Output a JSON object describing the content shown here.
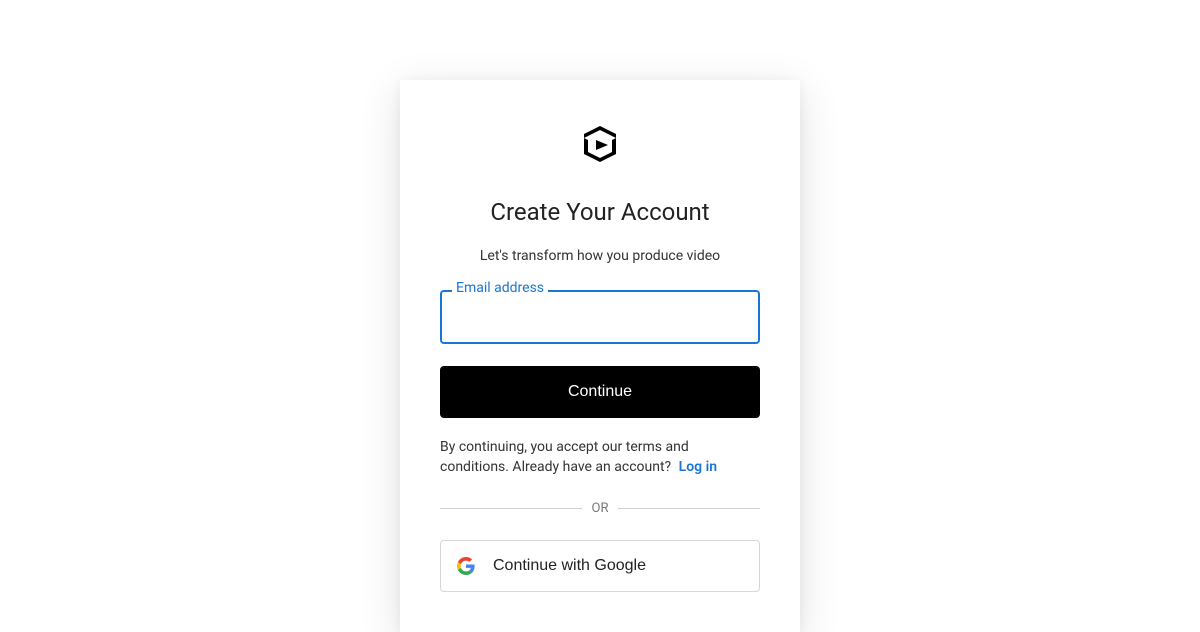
{
  "header": {
    "title": "Create Your Account",
    "subtitle": "Let's transform how you produce video"
  },
  "form": {
    "email_label": "Email address",
    "email_value": "",
    "continue_label": "Continue"
  },
  "legal": {
    "text": "By continuing, you accept our terms and conditions. Already have an account?",
    "login_label": "Log in"
  },
  "divider": {
    "label": "OR"
  },
  "oauth": {
    "google_label": "Continue with Google"
  }
}
